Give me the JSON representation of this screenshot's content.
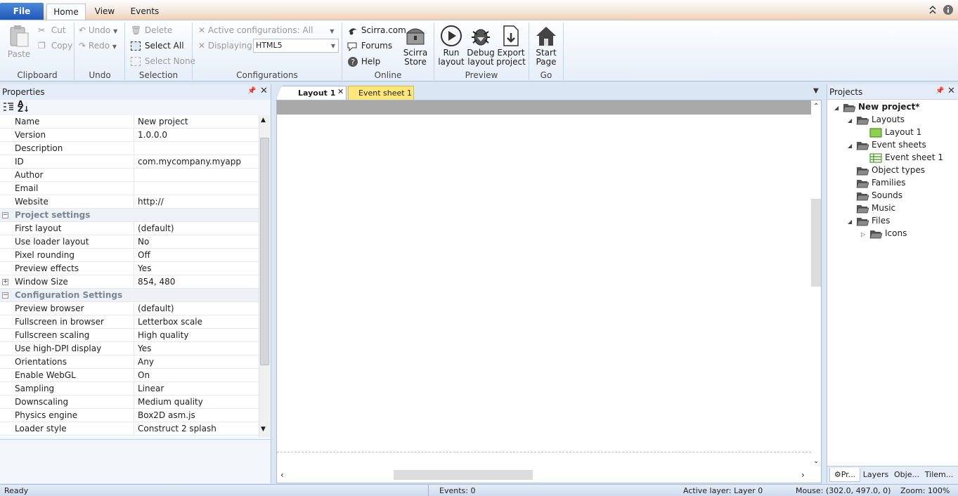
{
  "ribbon": {
    "file_label": "File",
    "tabs": [
      "Home",
      "View",
      "Events"
    ],
    "clipboard": {
      "paste": "Paste",
      "cut": "Cut",
      "copy": "Copy",
      "group": "Clipboard"
    },
    "undo": {
      "undo": "Undo",
      "redo": "Redo",
      "group": "Undo"
    },
    "selection": {
      "delete": "Delete",
      "select_all": "Select All",
      "select_none": "Select None",
      "group": "Selection"
    },
    "configurations": {
      "active": "Active configurations: All",
      "displaying_label": "Displaying:",
      "displaying_value": "HTML5",
      "group": "Configurations"
    },
    "online": {
      "scirra": "Scirra.com",
      "forums": "Forums",
      "help": "Help",
      "store_line1": "Scirra",
      "store_line2": "Store",
      "group": "Online"
    },
    "preview": {
      "run_1": "Run",
      "run_2": "layout",
      "debug_1": "Debug",
      "debug_2": "layout",
      "export_1": "Export",
      "export_2": "project",
      "group": "Preview"
    },
    "go": {
      "start_1": "Start",
      "start_2": "Page",
      "group": "Go"
    }
  },
  "properties": {
    "title": "Properties",
    "rows": [
      {
        "name": "Name",
        "value": "New project"
      },
      {
        "name": "Version",
        "value": "1.0.0.0"
      },
      {
        "name": "Description",
        "value": ""
      },
      {
        "name": "ID",
        "value": "com.mycompany.myapp"
      },
      {
        "name": "Author",
        "value": ""
      },
      {
        "name": "Email",
        "value": ""
      },
      {
        "name": "Website",
        "value": "http://"
      },
      {
        "name": "Project settings",
        "value": "",
        "category": true
      },
      {
        "name": "First layout",
        "value": "(default)"
      },
      {
        "name": "Use loader layout",
        "value": "No"
      },
      {
        "name": "Pixel rounding",
        "value": "Off"
      },
      {
        "name": "Preview effects",
        "value": "Yes"
      },
      {
        "name": "Window Size",
        "value": "854, 480",
        "expandable": true
      },
      {
        "name": "Configuration Settings",
        "value": "",
        "category": true
      },
      {
        "name": "Preview browser",
        "value": "(default)"
      },
      {
        "name": "Fullscreen in browser",
        "value": "Letterbox scale"
      },
      {
        "name": "Fullscreen scaling",
        "value": "High quality"
      },
      {
        "name": "Use high-DPI display",
        "value": "Yes"
      },
      {
        "name": "Orientations",
        "value": "Any"
      },
      {
        "name": "Enable WebGL",
        "value": "On"
      },
      {
        "name": "Sampling",
        "value": "Linear"
      },
      {
        "name": "Downscaling",
        "value": "Medium quality"
      },
      {
        "name": "Physics engine",
        "value": "Box2D asm.js"
      },
      {
        "name": "Loader style",
        "value": "Construct 2 splash"
      }
    ]
  },
  "doc_tabs": {
    "layout": "Layout 1",
    "events": "Event sheet 1"
  },
  "projects": {
    "title": "Projects",
    "tree": [
      {
        "label": "New project*",
        "indent": 0,
        "bold": true,
        "expander": "down",
        "icon": "folder-open"
      },
      {
        "label": "Layouts",
        "indent": 1,
        "expander": "down",
        "icon": "folder-open"
      },
      {
        "label": "Layout 1",
        "indent": 2,
        "icon": "layout"
      },
      {
        "label": "Event sheets",
        "indent": 1,
        "expander": "down",
        "icon": "folder-open"
      },
      {
        "label": "Event sheet 1",
        "indent": 2,
        "icon": "eventsheet"
      },
      {
        "label": "Object types",
        "indent": 1,
        "icon": "folder-open"
      },
      {
        "label": "Families",
        "indent": 1,
        "icon": "folder-open"
      },
      {
        "label": "Sounds",
        "indent": 1,
        "icon": "folder-open"
      },
      {
        "label": "Music",
        "indent": 1,
        "icon": "folder-open"
      },
      {
        "label": "Files",
        "indent": 1,
        "expander": "down",
        "icon": "folder-open"
      },
      {
        "label": "Icons",
        "indent": 2,
        "expander": "right",
        "icon": "folder-open"
      }
    ],
    "bottom_tabs": [
      "Pr...",
      "Layers",
      "Obje...",
      "Tilem..."
    ]
  },
  "status": {
    "ready": "Ready",
    "events": "Events: 0",
    "active_layer": "Active layer: Layer 0",
    "mouse": "Mouse: (302.0, 497.0, 0)",
    "zoom": "Zoom: 100%"
  }
}
